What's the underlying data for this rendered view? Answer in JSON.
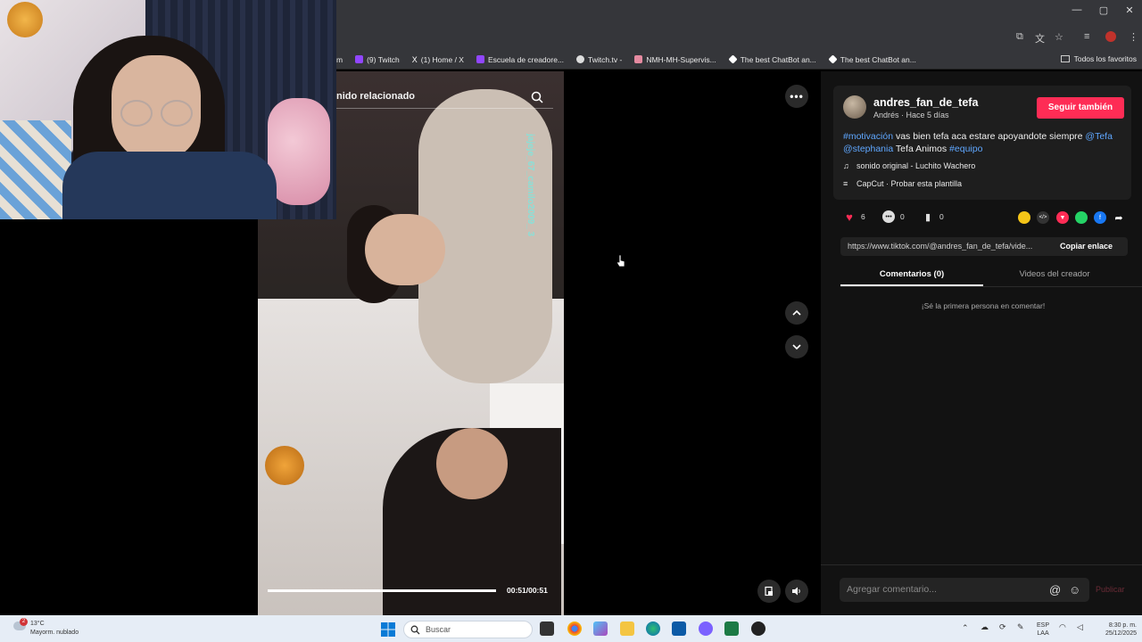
{
  "browser": {
    "window_controls": [
      "—",
      "▢",
      "✕"
    ],
    "bookmarks": [
      {
        "label": "m",
        "color": "#9146ff"
      },
      {
        "label": "(9) Twitch",
        "color": "#9146ff"
      },
      {
        "label": "(1) Home / X",
        "color": "#ffffff"
      },
      {
        "label": "Escuela de creadore...",
        "color": "#9146ff"
      },
      {
        "label": "Twitch.tv -",
        "color": "#dddddd"
      },
      {
        "label": "NMH-MH-Supervis...",
        "color": "#e58aa0"
      },
      {
        "label": "The best ChatBot an...",
        "color": "#ffffff"
      },
      {
        "label": "The best ChatBot an...",
        "color": "#ffffff"
      }
    ],
    "all_bookmarks": "Todos los favoritos"
  },
  "video": {
    "search_text": "nido relacionado",
    "watermark": "jajeje_67_camilo2009_ 3",
    "time": "00:51/00:51",
    "progress": 1.0
  },
  "panel": {
    "username": "andres_fan_de_tefa",
    "subtitle": "Andrés · Hace 5 días",
    "follow_label": "Seguir también",
    "desc_parts": [
      {
        "text": "#motivación",
        "tag": true
      },
      {
        "text": " vas bien tefa aca estare apoyandote siempre ",
        "tag": false
      },
      {
        "text": "@Tefa",
        "tag": true
      },
      {
        "text": " ",
        "tag": false
      },
      {
        "text": "@stephania",
        "tag": true
      },
      {
        "text": " Tefa Animos ",
        "tag": false
      },
      {
        "text": "#equipo",
        "tag": true
      }
    ],
    "sound": "sonido original - Luchito Wachero",
    "template": "CapCut · Probar esta plantilla",
    "likes": "6",
    "comments": "0",
    "saves": "0",
    "link": "https://www.tiktok.com/@andres_fan_de_tefa/vide...",
    "copy_link": "Copiar enlace",
    "tab_comments": "Comentarios (0)",
    "tab_videos": "Videos del creador",
    "empty": "¡Sé la primera persona en comentar!",
    "comment_placeholder": "Agregar comentario...",
    "publish": "Publicar"
  },
  "taskbar": {
    "weather_temp": "13°C",
    "weather_desc": "Mayorm. nublado",
    "weather_badge": "2",
    "search": "Buscar",
    "lang1": "ESP",
    "lang2": "LAA",
    "time": "8:30 p. m.",
    "date": "25/12/2025"
  }
}
